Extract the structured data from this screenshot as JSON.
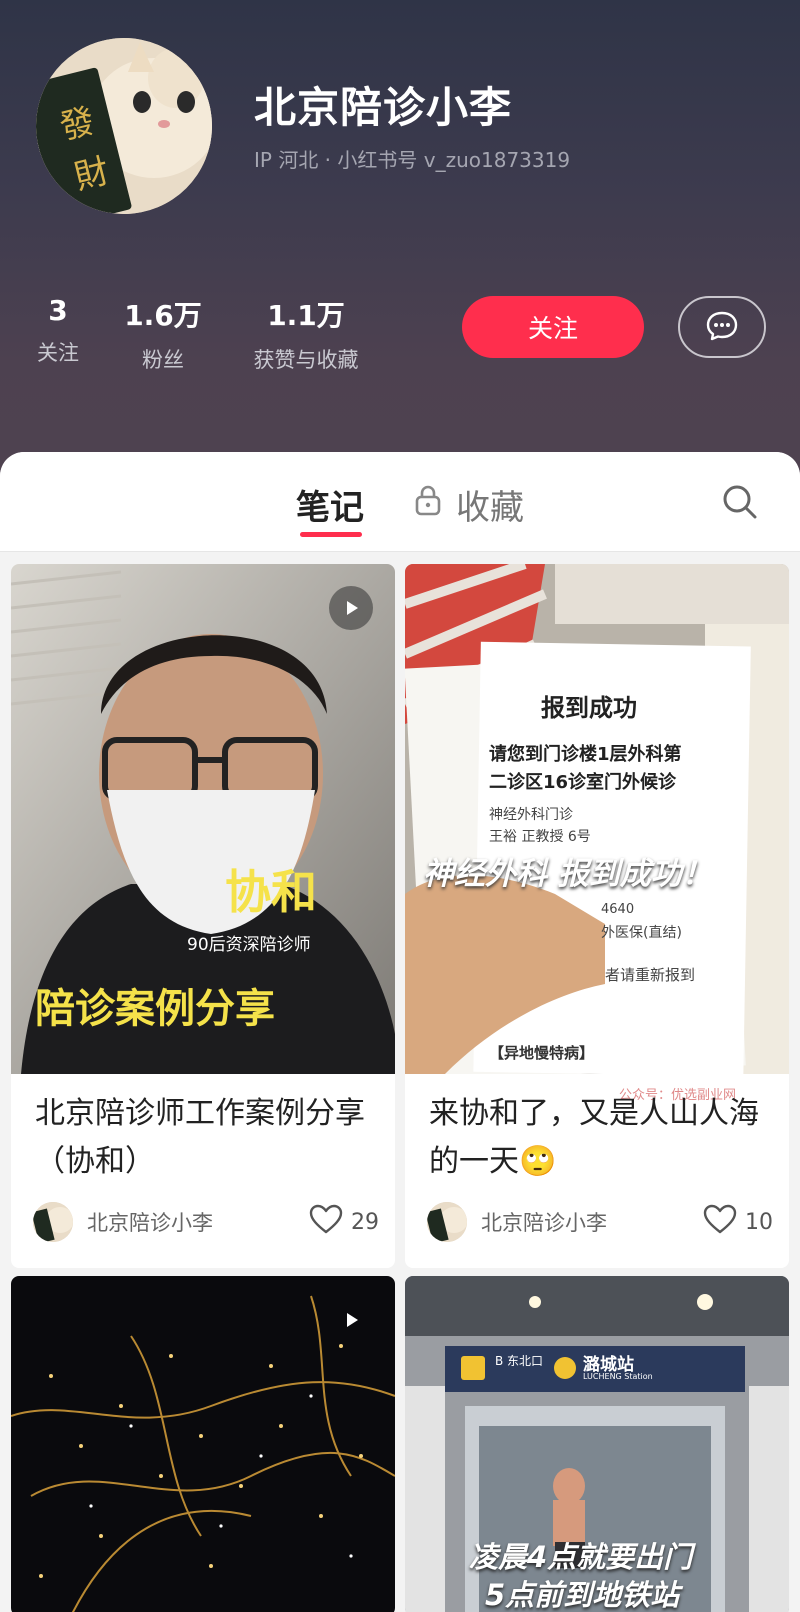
{
  "profile": {
    "nickname": "北京陪诊小李",
    "ip_line": "IP 河北 · 小红书号 v_zuo1873319",
    "avatar_text": "發財",
    "stats": [
      {
        "num": "3",
        "label": "关注"
      },
      {
        "num": "1.6万",
        "label": "粉丝"
      },
      {
        "num": "1.1万",
        "label": "获赞与收藏"
      }
    ],
    "follow_label": "关注",
    "chat_icon": "chat-bubble-icon"
  },
  "tabs": {
    "notes": "笔记",
    "collect": "收藏",
    "collect_icon": "lock-icon",
    "search_icon": "search-icon"
  },
  "notes": [
    {
      "title": "北京陪诊师工作案例分享（协和）",
      "author": "北京陪诊小李",
      "likes": "29",
      "is_video": true,
      "cover_text": {
        "main": "协和",
        "sub": "90后资深陪诊师",
        "bottom": "陪诊案例分享"
      }
    },
    {
      "title": "来协和了，又是人山人海的一天🙄",
      "author": "北京陪诊小李",
      "likes": "10",
      "is_video": false,
      "cover_text": {
        "slip_title": "报到成功",
        "slip_line1": "请您到门诊楼1层外科第",
        "slip_line2": "二诊区16诊室门外候诊",
        "slip_line3": "神经外科门诊",
        "slip_line4": "王裕  正教授  6号",
        "slip_line5": "4640",
        "slip_line6": "外医保(直结)",
        "slip_line7": "者请重新报到",
        "slip_line8": "【异地慢特病】",
        "overlay": "神经外科 报到成功！",
        "watermark": "公众号：优选副业网"
      }
    },
    {
      "title": "",
      "is_video": true,
      "cover_text": {}
    },
    {
      "title": "",
      "is_video": false,
      "cover_text": {
        "station_name": "潞城站",
        "station_en": "LUCHENG Station",
        "exit": "B 东北口",
        "line1": "凌晨4点就要出门",
        "line2": "5点前到地铁站"
      }
    }
  ],
  "colors": {
    "accent": "#ff2e4d",
    "header_top": "#2f3447",
    "header_bottom": "#4f4250"
  }
}
